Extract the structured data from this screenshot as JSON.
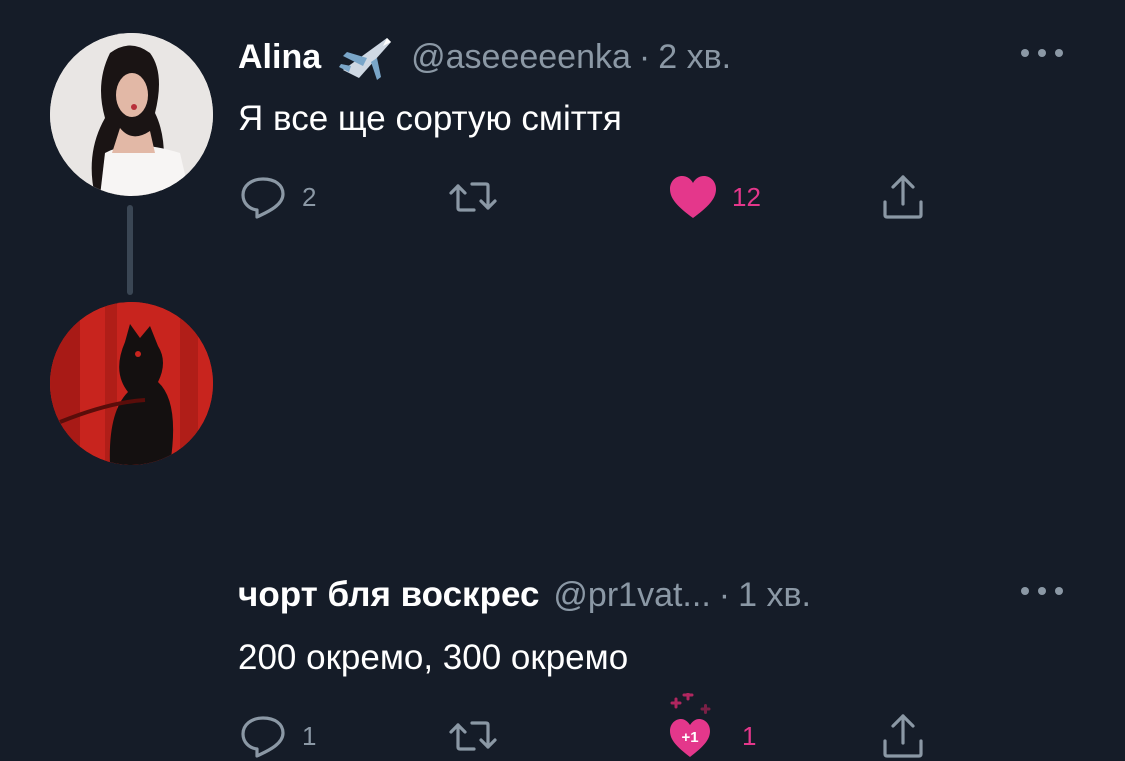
{
  "tweets": [
    {
      "name": "Alina",
      "name_emoji": "airplane-icon",
      "handle": "@aseeeeenka",
      "separator": "·",
      "time": "2 хв.",
      "text": "Я все ще сортую сміття",
      "reply_count": "2",
      "retweet_count": "",
      "like_count": "12",
      "liked": true
    },
    {
      "name": "чорт бля воскрес",
      "handle": "@pr1vat...",
      "separator": "·",
      "time": "1 хв.",
      "text": "200 окремо, 300 окремо",
      "reply_count": "1",
      "retweet_count": "",
      "like_count": "1",
      "like_badge": "+1",
      "liked": true
    }
  ],
  "colors": {
    "background": "#151c28",
    "muted": "#8b98a5",
    "like": "#e4378b",
    "thread_line": "#3a4654"
  }
}
